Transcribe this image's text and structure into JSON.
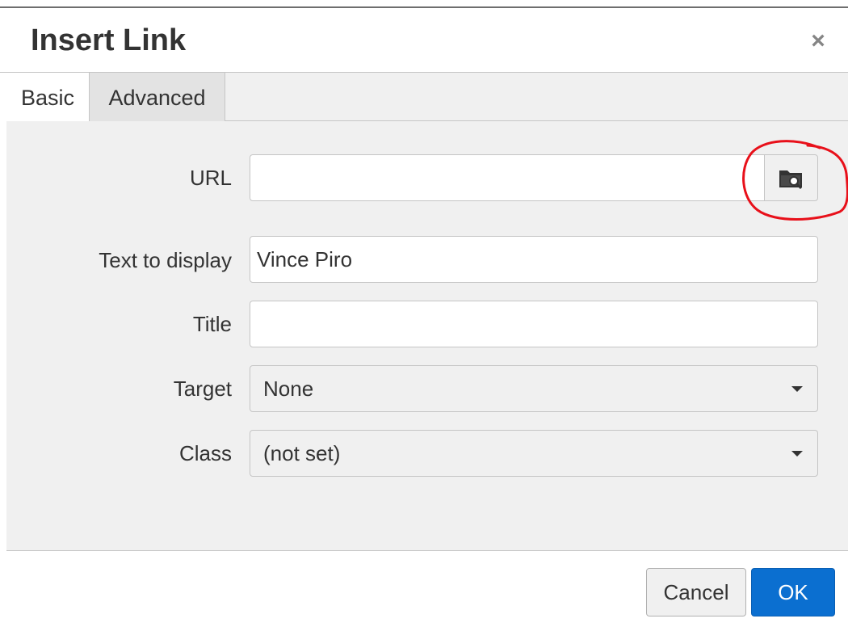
{
  "dialog": {
    "title": "Insert Link",
    "close_glyph": "×"
  },
  "tabs": [
    {
      "label": "Basic",
      "selected": true
    },
    {
      "label": "Advanced",
      "selected": false
    }
  ],
  "form": {
    "url": {
      "label": "URL",
      "value": "",
      "browse_icon": "folder-search-icon"
    },
    "text_to_display": {
      "label": "Text to display",
      "value": "Vince Piro"
    },
    "title": {
      "label": "Title",
      "value": ""
    },
    "target": {
      "label": "Target",
      "selected": "None"
    },
    "class": {
      "label": "Class",
      "selected": "(not set)"
    }
  },
  "footer": {
    "cancel_label": "Cancel",
    "ok_label": "OK"
  },
  "colors": {
    "primary_button": "#0b6fd0",
    "panel_background": "#f0f0f0",
    "annotation_circle": "#e8101a"
  }
}
